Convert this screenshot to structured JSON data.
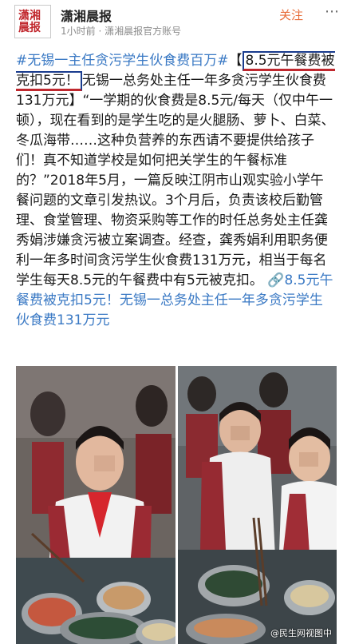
{
  "account": {
    "logo_text": [
      "潇湘",
      "晨报"
    ],
    "name": "潇湘晨报",
    "meta": "1小时前 · 潇湘晨报官方账号",
    "follow_label": "关注",
    "more_icon": "more-dots-icon"
  },
  "post": {
    "topic": "#无锡一主任贪污学生伙食费百万#",
    "boxed_open": "【",
    "boxed_text": "8.5元午餐费被克扣5元！",
    "body": "无锡一总务处主任一年多贪污学生伙食费131万元】“一学期的伙食费是8.5元/每天（仅中午一顿），现在看到的是学生吃的是火腿肠、萝卜、白菜、冬瓜海带……这种负营养的东西请不要提供给孩子们！真不知道学校是如何把关学生的午餐标准的？”2018年5月，一篇反映江阴市山观实验小学午餐问题的文章引发热议。3个月后，负责该校后勤管理、食堂管理、物资采购等工作的时任总务处主任龚秀娟涉嫌贪污被立案调查。经查，龚秀娟利用职务便利一年多时间贪污学生伙食费131万元，相当于每名学生每天8.5元的午餐费中有5元被克扣。",
    "link_icon": "link-icon",
    "link_text": "8.5元午餐费被克扣5元！无锡一总务处主任一年多贪污学生伙食费131万元"
  },
  "photos": {
    "watermark": "@民生网视图中"
  }
}
